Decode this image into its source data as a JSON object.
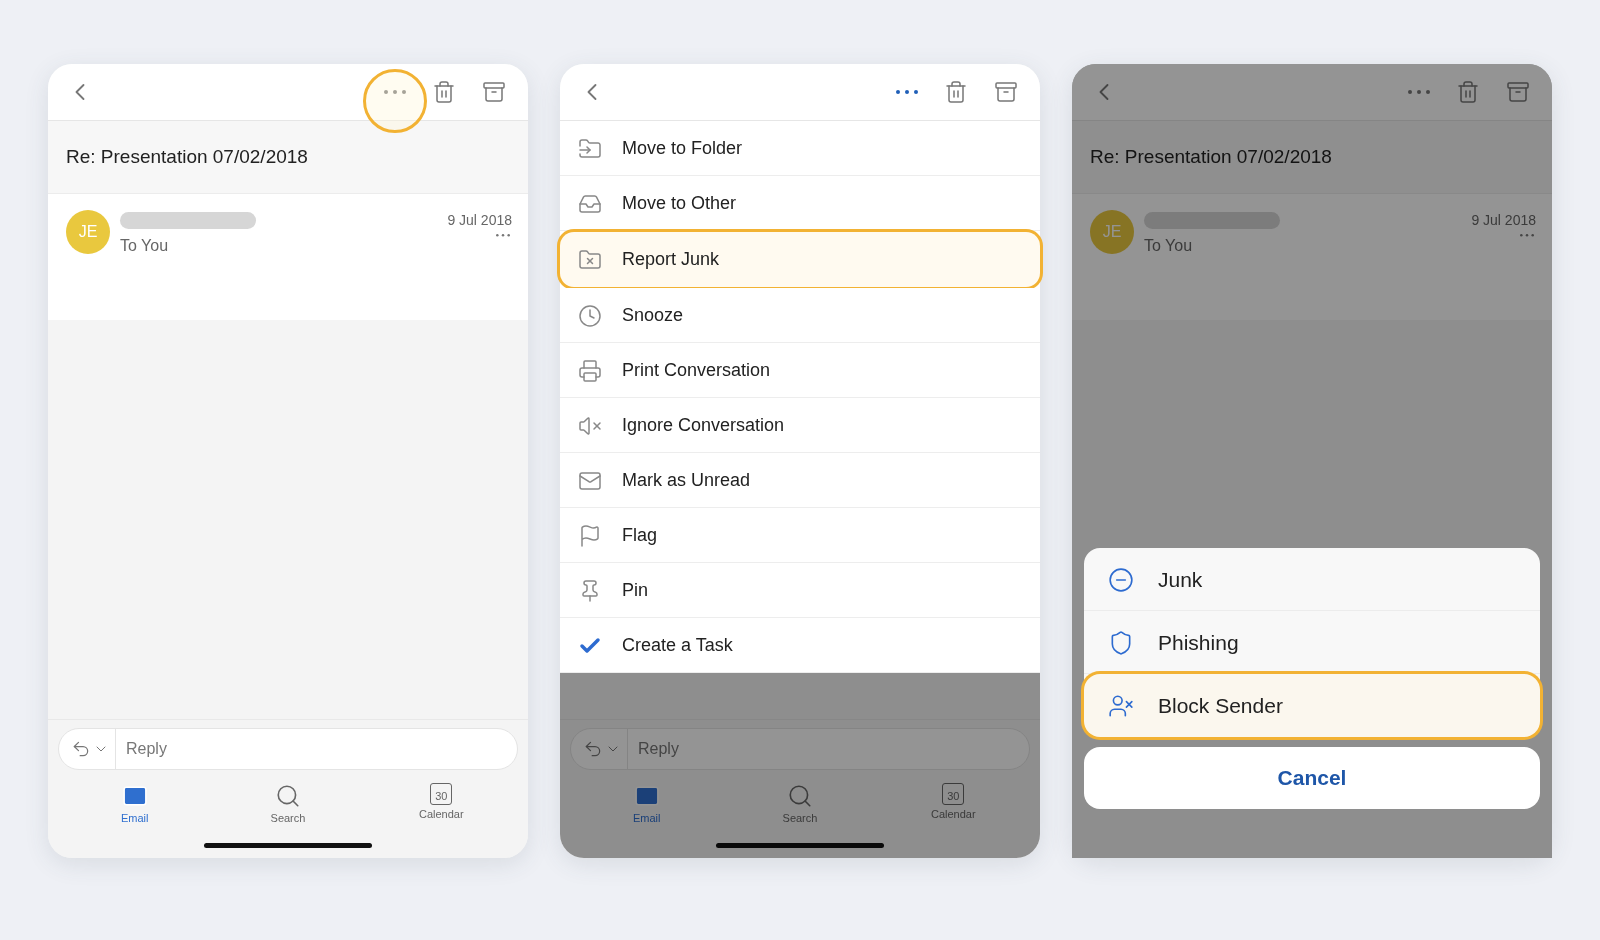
{
  "screens": [
    {
      "kind": "plain",
      "more_ringed": true,
      "more_active": false,
      "subject": "Re: Presentation 07/02/2018",
      "message": {
        "avatar": "JE",
        "recipient": "To You",
        "date": "9 Jul 2018"
      },
      "reply": {
        "placeholder": "Reply"
      },
      "tabs": [
        {
          "label": "Email",
          "kind": "mail",
          "selected": true
        },
        {
          "label": "Search",
          "kind": "search",
          "selected": false
        },
        {
          "label": "Calendar",
          "kind": "calendar",
          "badge": "30",
          "selected": false
        }
      ]
    },
    {
      "kind": "menu",
      "more_ringed": false,
      "more_active": true,
      "menu": [
        {
          "label": "Move to Folder",
          "kind": "folder-move",
          "highlighted": false
        },
        {
          "label": "Move to Other",
          "kind": "inbox-move",
          "highlighted": false
        },
        {
          "label": "Report Junk",
          "kind": "folder-block",
          "highlighted": true
        },
        {
          "label": "Snooze",
          "kind": "clock",
          "highlighted": false
        },
        {
          "label": "Print Conversation",
          "kind": "printer",
          "highlighted": false
        },
        {
          "label": "Ignore Conversation",
          "kind": "mute",
          "highlighted": false
        },
        {
          "label": "Mark as Unread",
          "kind": "mail",
          "highlighted": false
        },
        {
          "label": "Flag",
          "kind": "flag",
          "highlighted": false
        },
        {
          "label": "Pin",
          "kind": "pin",
          "highlighted": false
        },
        {
          "label": "Create a Task",
          "kind": "check",
          "highlighted": false
        }
      ],
      "reply": {
        "placeholder": "Reply"
      },
      "tabs": [
        {
          "label": "Email",
          "kind": "mail",
          "selected": true
        },
        {
          "label": "Search",
          "kind": "search",
          "selected": false
        },
        {
          "label": "Calendar",
          "kind": "calendar",
          "badge": "30",
          "selected": false
        }
      ]
    },
    {
      "kind": "sheet",
      "more_ringed": false,
      "more_active": false,
      "subject": "Re: Presentation 07/02/2018",
      "message": {
        "avatar": "JE",
        "recipient": "To You",
        "date": "9 Jul 2018"
      },
      "sheet": {
        "options": [
          {
            "label": "Junk",
            "kind": "circle-minus",
            "highlighted": false
          },
          {
            "label": "Phishing",
            "kind": "shield",
            "highlighted": false
          },
          {
            "label": "Block Sender",
            "kind": "block-user",
            "highlighted": true
          }
        ],
        "cancel": "Cancel"
      }
    }
  ]
}
